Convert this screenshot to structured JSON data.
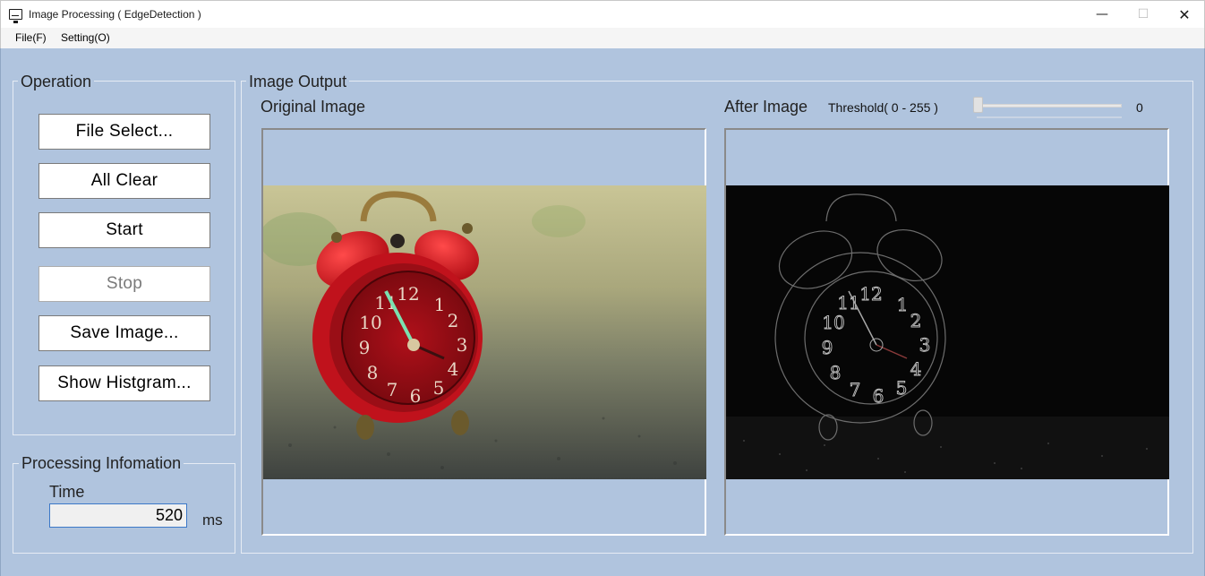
{
  "window": {
    "title": "Image Processing ( EdgeDetection )",
    "icon": "monitor-icon",
    "controls": {
      "minimize": "—",
      "maximize": "☐",
      "close": "✕"
    }
  },
  "menu": {
    "file": "File(F)",
    "setting": "Setting(O)"
  },
  "operation": {
    "title": "Operation",
    "buttons": {
      "file_select": "File Select...",
      "all_clear": "All Clear",
      "start": "Start",
      "stop": "Stop",
      "save_image": "Save Image...",
      "show_histogram": "Show Histgram..."
    },
    "stop_enabled": false
  },
  "processing_info": {
    "title": "Processing Infomation",
    "time_label": "Time",
    "time_value": "520",
    "unit": "ms"
  },
  "image_output": {
    "title": "Image Output",
    "original_label": "Original Image",
    "after_label": "After Image",
    "threshold_label": "Threshold( 0 - 255 )",
    "threshold_value": "0",
    "threshold_min": 0,
    "threshold_max": 255
  },
  "colors": {
    "background": "#b0c4de",
    "clock_red": "#c8141e",
    "edge_dark": "#0a0a0a"
  }
}
